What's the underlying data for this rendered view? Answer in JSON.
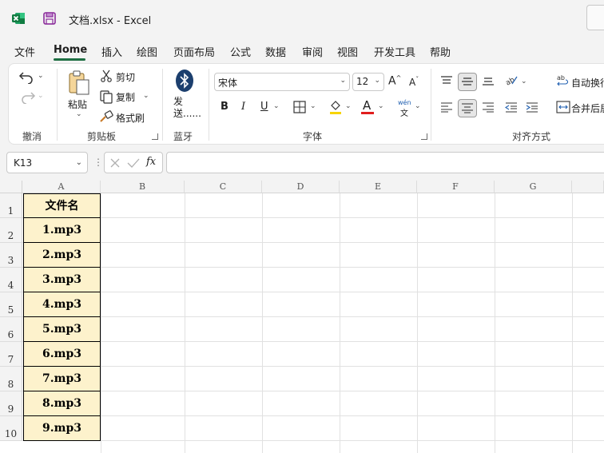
{
  "titlebar": {
    "doc_title": "文档.xlsx  -  Excel"
  },
  "menu": {
    "tabs": [
      {
        "label": "文件"
      },
      {
        "label": "Home"
      },
      {
        "label": "插入"
      },
      {
        "label": "绘图"
      },
      {
        "label": "页面布局"
      },
      {
        "label": "公式"
      },
      {
        "label": "数据"
      },
      {
        "label": "审阅"
      },
      {
        "label": "视图"
      },
      {
        "label": "开发工具"
      },
      {
        "label": "帮助"
      }
    ],
    "active": "Home"
  },
  "ribbon": {
    "undo_group": {
      "label": "撤消"
    },
    "clipboard": {
      "label": "剪贴板",
      "paste": "粘贴",
      "cut": "剪切",
      "copy": "复制",
      "format_painter": "格式刷"
    },
    "bluetooth": {
      "label": "蓝牙",
      "send": "发送......"
    },
    "font": {
      "label": "字体",
      "font_name": "宋体",
      "font_size": "12",
      "wen": "wén",
      "wen_char": "文"
    },
    "alignment": {
      "label": "对齐方式",
      "wrap_text": "自动换行",
      "merge_center": "合并后居中"
    }
  },
  "formula_bar": {
    "name_box": "K13",
    "formula": ""
  },
  "sheet": {
    "columns": [
      "A",
      "B",
      "C",
      "D",
      "E",
      "F",
      "G"
    ],
    "rows": [
      "1",
      "2",
      "3",
      "4",
      "5",
      "6",
      "7",
      "8",
      "9",
      "10"
    ],
    "col_a_values": [
      "文件名",
      "1.mp3",
      "2.mp3",
      "3.mp3",
      "4.mp3",
      "5.mp3",
      "6.mp3",
      "7.mp3",
      "8.mp3",
      "9.mp3"
    ],
    "highlight_color": "#fdf2cc",
    "accent_color": "#1e6e43"
  }
}
